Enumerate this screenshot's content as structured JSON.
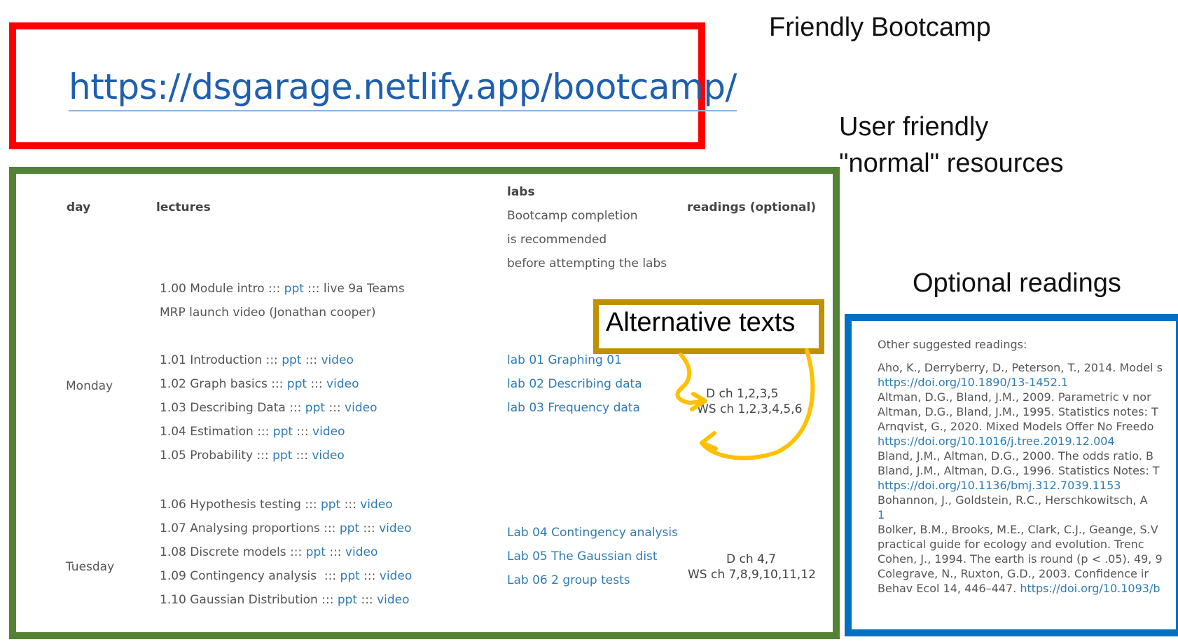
{
  "url_box": {
    "url": "https://dsgarage.netlify.app/bootcamp/"
  },
  "callouts": {
    "friendly": "Friendly Bootcamp",
    "user_friendly_1": "User friendly",
    "user_friendly_2": "\"normal\" resources",
    "optional": "Optional readings",
    "alternative": "Alternative texts"
  },
  "schedule": {
    "headers": {
      "day": "day",
      "lectures": "lectures",
      "labs": "labs",
      "labs_note": [
        "Bootcamp completion",
        "is recommended",
        "before attempting the labs"
      ],
      "readings": "readings (optional)"
    },
    "intro": {
      "line1_prefix": "1.00 Module intro ::: ",
      "line1_link": "ppt",
      "line1_suffix": " ::: live 9a Teams",
      "line2_link": "MRP launch video (Jonathan cooper)"
    },
    "days": [
      {
        "name": "Monday",
        "lectures": [
          {
            "label": "1.01 Introduction ::: ",
            "ppt": "ppt",
            "sep": " ::: ",
            "video": "video"
          },
          {
            "label": "1.02 Graph basics ::: ",
            "ppt": "ppt",
            "sep": " ::: ",
            "video": "video"
          },
          {
            "label": "1.03 Describing Data ::: ",
            "ppt": "ppt",
            "sep": " ::: ",
            "video": "video"
          },
          {
            "label": "1.04 Estimation ::: ",
            "ppt": "ppt",
            "sep": " ::: ",
            "video": "video"
          },
          {
            "label": "1.05 Probability ::: ",
            "ppt": "ppt",
            "sep": " ::: ",
            "video": "video"
          }
        ],
        "labs": [
          "lab 01 Graphing 01",
          "lab 02 Describing data",
          "lab 03 Frequency data"
        ],
        "readings": [
          "D ch 1,2,3,5",
          "WS ch 1,2,3,4,5,6"
        ]
      },
      {
        "name": "Tuesday",
        "lectures": [
          {
            "label": "1.06 Hypothesis testing ::: ",
            "ppt": "ppt",
            "sep": " ::: ",
            "video": "video"
          },
          {
            "label": "1.07 Analysing proportions ::: ",
            "ppt": "ppt",
            "sep": " ::: ",
            "video": "video"
          },
          {
            "label": "1.08 Discrete models ::: ",
            "ppt": "ppt",
            "sep": " ::: ",
            "video": "video"
          },
          {
            "label": "1.09 Contingency analysis  ::: ",
            "ppt": "ppt",
            "sep": " ::: ",
            "video": "video"
          },
          {
            "label": "1.10 Gaussian Distribution ::: ",
            "ppt": "ppt",
            "sep": " ::: ",
            "video": "video"
          }
        ],
        "labs": [
          "Lab 04 Contingency analysis",
          "Lab 05 The Gaussian dist",
          "Lab 06 2 group tests"
        ],
        "readings": [
          "D ch 4,7",
          "WS ch 7,8,9,10,11,12"
        ]
      }
    ]
  },
  "readings_panel": {
    "heading": "Other suggested readings:",
    "refs": [
      {
        "text": "Aho, K., Derryberry, D., Peterson, T., 2014. Model s",
        "link": false
      },
      {
        "text": "https://doi.org/10.1890/13-1452.1",
        "link": true
      },
      {
        "text": "Altman, D.G., Bland, J.M., 2009. Parametric v nor",
        "link": false
      },
      {
        "text": "Altman, D.G., Bland, J.M., 1995. Statistics notes: T",
        "link": false
      },
      {
        "text": "Arnqvist, G., 2020. Mixed Models Offer No Freedo",
        "link": false
      },
      {
        "text": "https://doi.org/10.1016/j.tree.2019.12.004",
        "link": true
      },
      {
        "text": "Bland, J.M., Altman, D.G., 2000. The odds ratio. B",
        "link": false
      },
      {
        "text": "Bland, J.M., Altman, D.G., 1996. Statistics Notes: T",
        "link": false
      },
      {
        "text": "https://doi.org/10.1136/bmj.312.7039.1153",
        "link": true
      },
      {
        "text": "Bohannon, J., Goldstein, R.C., Herschkowitsch, A",
        "link": false
      },
      {
        "text": "1",
        "link": true
      },
      {
        "text": "Bolker, B.M., Brooks, M.E., Clark, C.J., Geange, S.V",
        "link": false
      },
      {
        "text": "practical guide for ecology and evolution. Trenc",
        "link": false
      },
      {
        "text": "Cohen, J., 1994. The earth is round (p < .05). 49, 9",
        "link": false
      },
      {
        "text": "Colegrave, N., Ruxton, G.D., 2003. Confidence ir",
        "link": false
      },
      {
        "text": "Behav Ecol 14, 446–447. ",
        "link": false,
        "tail": "https://doi.org/10.1093/b"
      }
    ]
  },
  "colors": {
    "url_box_border": "#ff0000",
    "schedule_border": "#548235",
    "alt_border": "#bf9000",
    "readings_border": "#0070c0",
    "arrow": "#ffc000",
    "link": "#2e7bb5"
  }
}
